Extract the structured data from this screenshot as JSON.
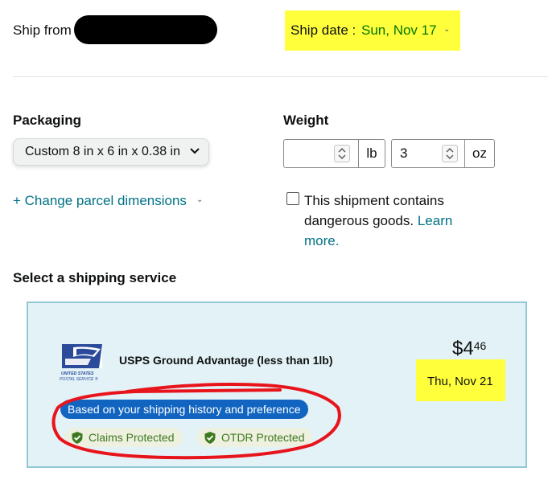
{
  "header": {
    "ship_from_label": "Ship from",
    "ship_date_label": "Ship date :",
    "ship_date_value": "Sun, Nov 17",
    "ship_date_chevron": "⌄"
  },
  "packaging": {
    "label": "Packaging",
    "selected": "Custom 8 in x 6 in x 0.38 in",
    "change_dimensions_link": "+ Change parcel dimensions",
    "change_chevron": "⌄"
  },
  "weight": {
    "label": "Weight",
    "lb_value": "",
    "lb_unit": "lb",
    "oz_value": "3",
    "oz_unit": "oz"
  },
  "dangerous_goods": {
    "text": "This shipment contains dangerous goods.",
    "link": "Learn more.",
    "checked": false
  },
  "shipping_service": {
    "section_title": "Select a shipping service",
    "option": {
      "carrier_logo_text": "UNITED STATES POSTAL SERVICE",
      "name": "USPS Ground Advantage (less than 1lb)",
      "price_dollars": "$4",
      "price_cents": "46",
      "delivery_date": "Thu, Nov 21",
      "recommendation_badge": "Based on your shipping history and preference",
      "protections": [
        "Claims Protected",
        "OTDR Protected"
      ]
    }
  },
  "colors": {
    "highlight": "#ffff3b",
    "link": "#007185",
    "green": "#007600",
    "badge_blue": "#1165c1",
    "card_bg": "#e3f2f7",
    "annotation_red": "#e8141b"
  }
}
